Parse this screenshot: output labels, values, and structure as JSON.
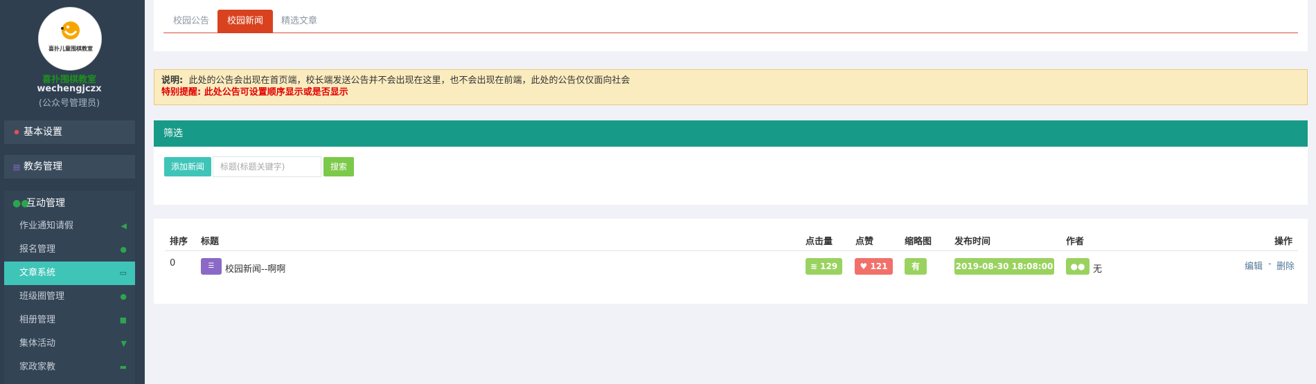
{
  "sidebar": {
    "logo_text": "喜扑儿童围棋教室",
    "school_name": "喜扑围棋教室",
    "username": "wechengjczx",
    "role": "(公众号管理员)",
    "menus": [
      {
        "label": "基本设置",
        "icon": "gear-icon"
      },
      {
        "label": "教务管理",
        "icon": "database-icon"
      },
      {
        "label": "互动管理",
        "icon": "chat-icon"
      }
    ],
    "sub_items": [
      {
        "label": "作业通知请假",
        "icon": "megaphone-icon"
      },
      {
        "label": "报名管理",
        "icon": "chat-icon"
      },
      {
        "label": "文章系统",
        "icon": "monitor-icon"
      },
      {
        "label": "班级圈管理",
        "icon": "chat-icon"
      },
      {
        "label": "相册管理",
        "icon": "camera-icon"
      },
      {
        "label": "集体活动",
        "icon": "trophy-icon"
      },
      {
        "label": "家政家教",
        "icon": "coffee-icon"
      }
    ]
  },
  "tabs": [
    "校园公告",
    "校园新闻",
    "精选文章"
  ],
  "active_tab": "校园新闻",
  "notice": {
    "label": "说明:",
    "text": "此处的公告会出现在首页端，校长端发送公告并不会出现在这里，也不会出现在前端，此处的公告仅仅面向社会",
    "warning": "特别提醒: 此处公告可设置顺序显示或是否显示"
  },
  "filter": {
    "title": "筛选",
    "add_button": "添加新闻",
    "search_placeholder": "标题(标题关键字)",
    "search_button": "搜索"
  },
  "table": {
    "headers": {
      "order": "排序",
      "title": "标题",
      "views": "点击量",
      "likes": "点赞",
      "thumbnail": "缩略图",
      "published": "发布时间",
      "author": "作者",
      "actions": "操作"
    },
    "rows": [
      {
        "order": "0",
        "title": "校园新闻--啊啊",
        "views": "129",
        "likes": "121",
        "thumbnail": "有",
        "published": "2019-08-30 18:08:00",
        "author": "无",
        "edit": "编辑",
        "sep": "-",
        "delete": "删除"
      }
    ]
  },
  "colors": {
    "sidebar_bg": "#2f3f50",
    "accent_teal": "#3fc4b8",
    "filter_header": "#179a88",
    "active_tab": "#d9421f",
    "green_pill": "#9ad25f",
    "red_pill": "#f2706a"
  }
}
